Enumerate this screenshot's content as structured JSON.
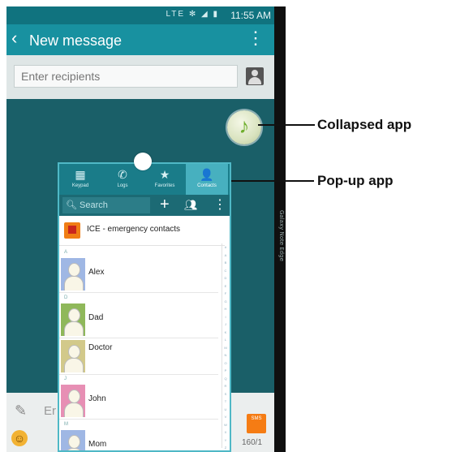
{
  "status": {
    "icons": "LTE ✻ ◢ ▮",
    "time": "11:55 AM"
  },
  "header": {
    "title": "New message"
  },
  "recipients": {
    "placeholder": "Enter recipients"
  },
  "compose": {
    "text": "Er",
    "counter": "160/1"
  },
  "edge_screen": {
    "label": "Galaxy Note Edge"
  },
  "popup": {
    "tabs": [
      {
        "label": "Keypad",
        "icon": "keypad-icon"
      },
      {
        "label": "Logs",
        "icon": "phone-logs-icon"
      },
      {
        "label": "Favorites",
        "icon": "star-icon"
      },
      {
        "label": "Contacts",
        "icon": "person-icon"
      }
    ],
    "search_placeholder": "Search",
    "ice_label": "ICE - emergency contacts",
    "sections": [
      "A",
      "D",
      "J",
      "M"
    ],
    "contacts": [
      "Alex",
      "Dad",
      "Doctor",
      "John",
      "Mom"
    ],
    "index_letters": [
      "#",
      "A",
      "B",
      "C",
      "D",
      "E",
      "F",
      "G",
      "H",
      "I",
      "J",
      "K",
      "L",
      "M",
      "N",
      "O",
      "P",
      "Q",
      "R",
      "S",
      "T",
      "U",
      "V",
      "W",
      "X",
      "Y",
      "Z"
    ]
  },
  "callouts": {
    "collapsed": "Collapsed app",
    "popup": "Pop-up app"
  }
}
